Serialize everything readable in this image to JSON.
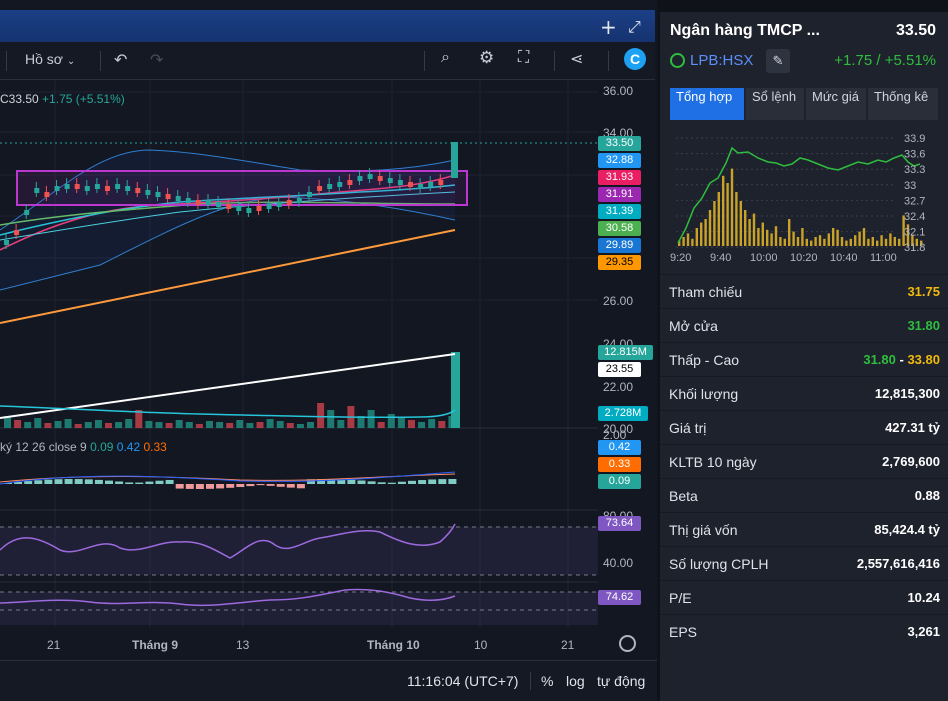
{
  "header": {
    "profile_label": "Hồ sơ",
    "timezone": "11:16:04 (UTC+7)",
    "pct_label": "%",
    "log_label": "log",
    "auto_label": "tự động"
  },
  "legend": {
    "price_prefix": "C",
    "price": "33.50",
    "change": "+1.75 (+5.51%)"
  },
  "macd_legend": {
    "name": "ký",
    "params": "12 26 close 9",
    "v1": "0.09",
    "v2": "0.42",
    "v3": "0.33"
  },
  "price_axis": {
    "tick_36": "36.00",
    "tick_34": "34.00",
    "tick_26": "26.00",
    "tick_24": "24.00",
    "tick_22": "22.00",
    "tick_20": "20.00",
    "tick_2": "2.00",
    "tick_80": "80.00",
    "tick_40": "40.00",
    "tag_last": "33.50",
    "tag_a": "32.88",
    "tag_b": "31.93",
    "tag_c": "31.91",
    "tag_d": "31.39",
    "tag_e": "30.58",
    "tag_f": "29.89",
    "tag_g": "29.35",
    "vol_tag": "12.815M",
    "vol_line": "23.55",
    "vol_ma": "2.728M",
    "macd_a": "0.42",
    "macd_b": "0.33",
    "macd_c": "0.09",
    "rsi": "73.64",
    "stoch": "74.62"
  },
  "x_axis": [
    "21",
    "Tháng 9",
    "13",
    "Tháng 10",
    "10",
    "21"
  ],
  "side": {
    "name": "Ngân hàng TMCP ...",
    "price": "33.50",
    "ticker": "LPB:HSX",
    "change": "+1.75 / +5.51%",
    "tabs": [
      "Tổng hợp",
      "Sổ lệnh",
      "Mức giá",
      "Thống kê"
    ],
    "mini_y": [
      "33.9",
      "33.6",
      "33.3",
      "33",
      "32.7",
      "32.4",
      "32.1",
      "31.8"
    ],
    "mini_x": [
      "9:20",
      "9:40",
      "10:00",
      "10:20",
      "10:40",
      "11:00"
    ],
    "rows": [
      {
        "label": "Tham chiếu",
        "value": "31.75"
      },
      {
        "label": "Mở cửa",
        "value": "31.80"
      },
      {
        "label": "Thấp - Cao",
        "value": "31.80",
        "value2": "33.80"
      },
      {
        "label": "Khối lượng",
        "value": "12,815,300"
      },
      {
        "label": "Giá trị",
        "value": "427.31 tỷ"
      },
      {
        "label": "KLTB 10 ngày",
        "value": "2,769,600"
      },
      {
        "label": "Beta",
        "value": "0.88"
      },
      {
        "label": "Thị giá vốn",
        "value": "85,424.4 tỷ"
      },
      {
        "label": "Số lượng CPLH",
        "value": "2,557,616,416"
      },
      {
        "label": "P/E",
        "value": "10.24"
      },
      {
        "label": "EPS",
        "value": "3,261"
      }
    ]
  },
  "colors": {
    "up": "#26a69a",
    "down": "#ef5350",
    "green": "#2ebd3e",
    "yellow": "#f0b90b",
    "purple": "#9c27b0"
  }
}
